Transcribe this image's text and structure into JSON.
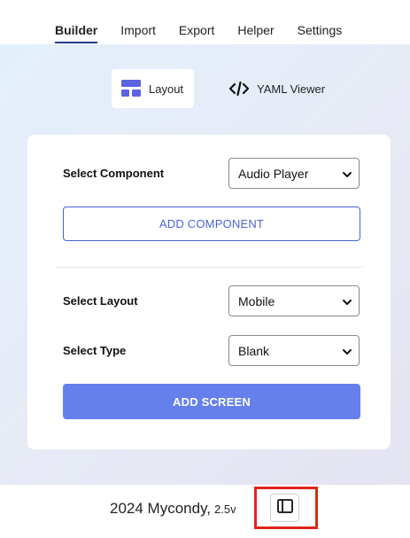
{
  "nav": {
    "tabs": [
      {
        "label": "Builder",
        "active": true
      },
      {
        "label": "Import"
      },
      {
        "label": "Export"
      },
      {
        "label": "Helper"
      },
      {
        "label": "Settings"
      }
    ]
  },
  "modes": {
    "layout_label": "Layout",
    "layout_icon": "layout-icon",
    "yaml_label": "YAML Viewer",
    "yaml_icon": "code-icon"
  },
  "card": {
    "component_label": "Select Component",
    "component_value": "Audio Player",
    "add_component_label": "ADD COMPONENT",
    "layout_label": "Select Layout",
    "layout_value": "Mobile",
    "type_label": "Select Type",
    "type_value": "Blank",
    "add_screen_label": "ADD SCREEN"
  },
  "footer": {
    "copyright": "2024 Mycondy,",
    "version": "2.5v",
    "panel_icon": "sidebar-toggle-icon"
  },
  "colors": {
    "accent": "#4a63d4",
    "primary_button": "#6580ec",
    "highlight": "#e3241b"
  }
}
